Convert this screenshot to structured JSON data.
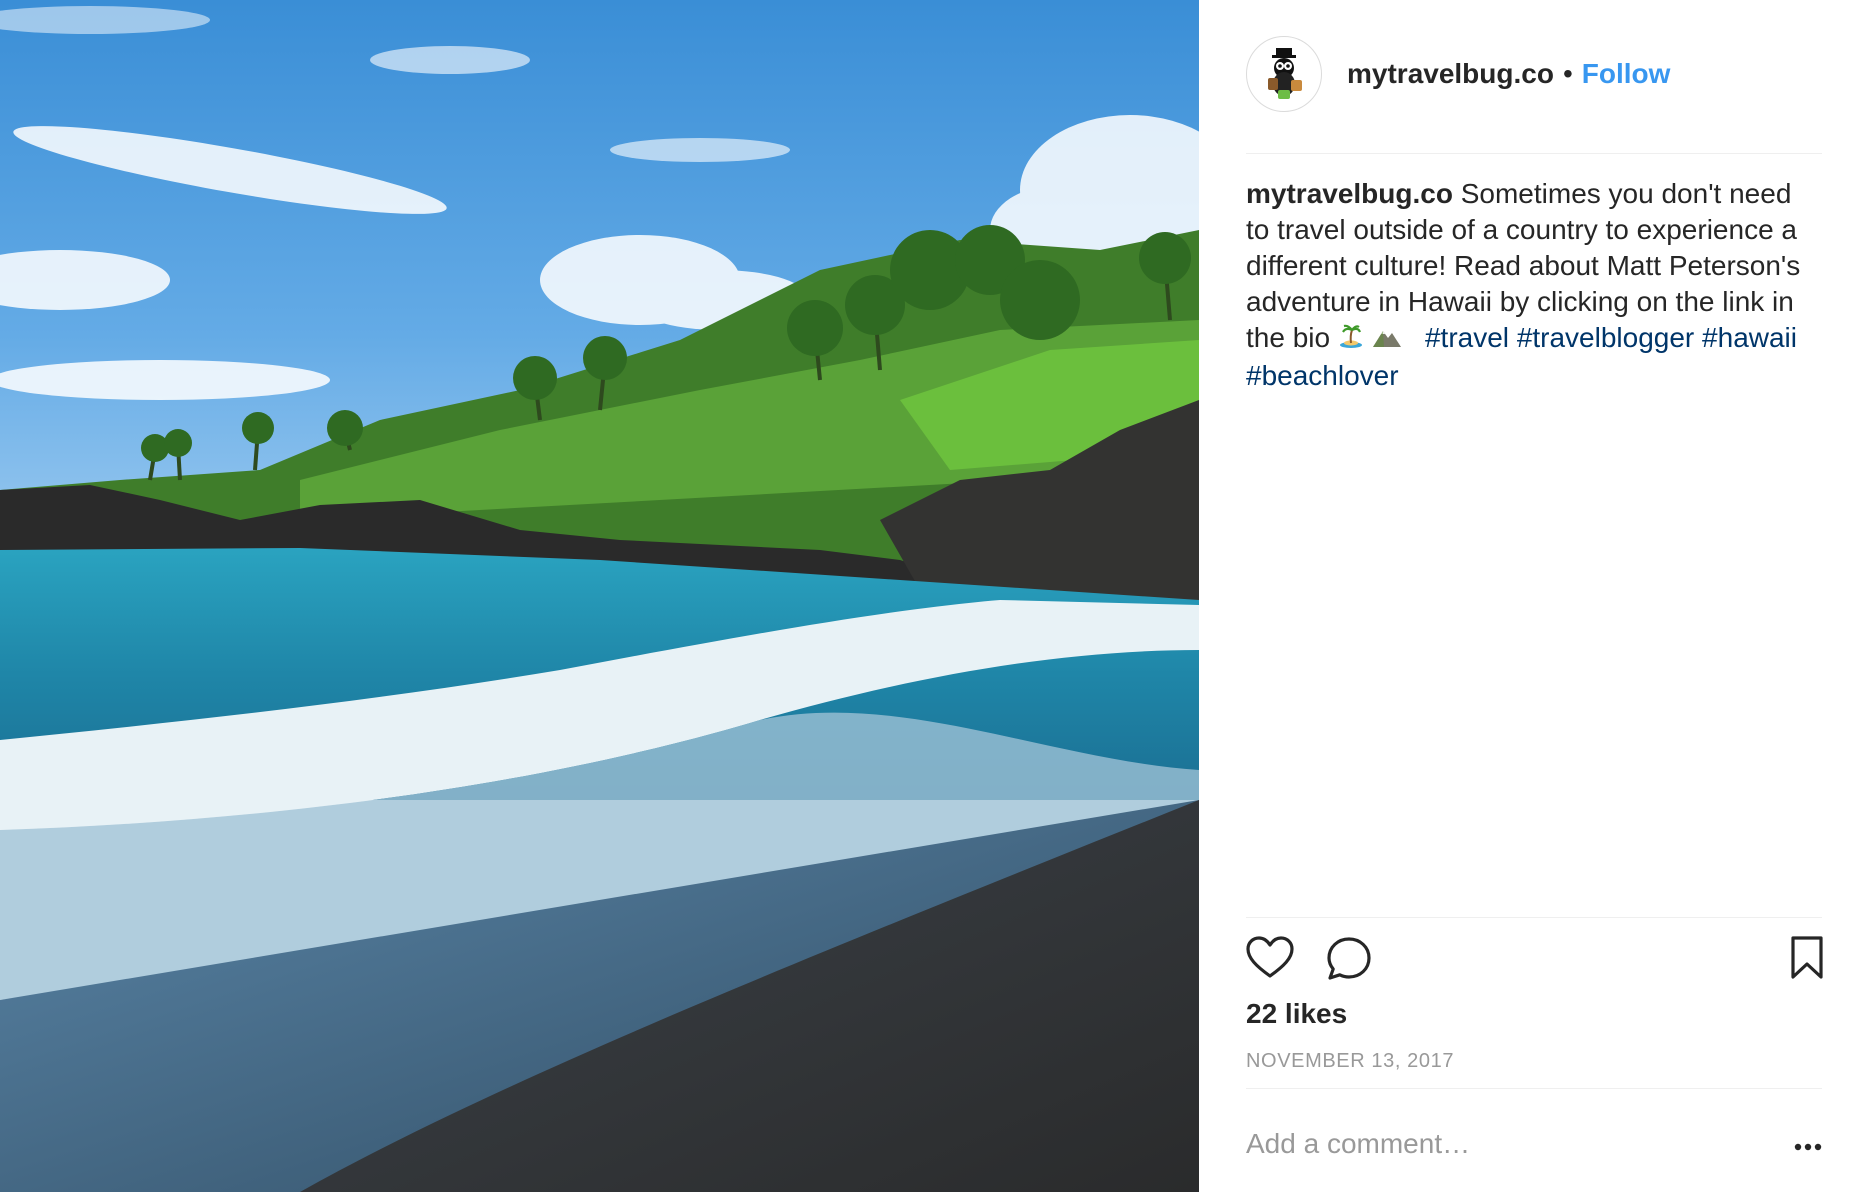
{
  "post": {
    "image_alt": "Black sand beach with turquoise waves, lava rocks and palm trees in Hawaii"
  },
  "header": {
    "username": "mytravelbug.co",
    "separator": "•",
    "follow_label": "Follow"
  },
  "caption": {
    "username": "mytravelbug.co",
    "text": "Sometimes you don't need to travel outside of a country to experience a different culture! Read about Matt Peterson's adventure in Hawaii by clicking on the link in the bio",
    "emoji_1": "🏝",
    "emoji_2": "⛰",
    "hashtags": [
      "#travel",
      "#travelblogger",
      "#hawaii",
      "#beachlover"
    ]
  },
  "actions": {
    "like_icon": "heart-icon",
    "comment_icon": "comment-bubble-icon",
    "save_icon": "bookmark-icon"
  },
  "likes_text": "22 likes",
  "date_text": "NOVEMBER 13, 2017",
  "comment": {
    "placeholder": "Add a comment…",
    "more_icon": "more-options-icon"
  },
  "colors": {
    "link_blue": "#3897f0",
    "hashtag_blue": "#003569",
    "muted_gray": "#999999",
    "text_dark": "#262626"
  }
}
